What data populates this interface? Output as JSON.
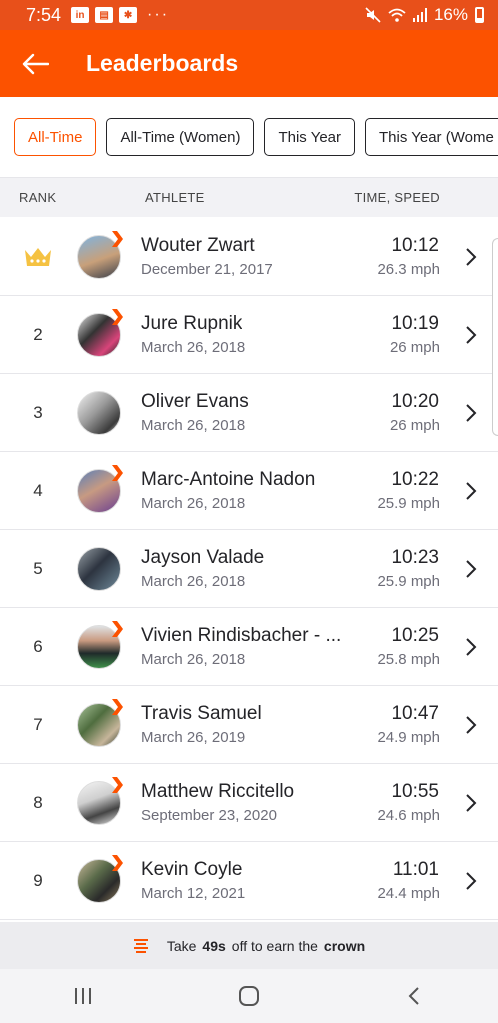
{
  "status_bar": {
    "time": "7:54",
    "icons": [
      "linkedin-icon",
      "news-icon",
      "nbc-icon"
    ],
    "battery": "16%"
  },
  "app_bar": {
    "title": "Leaderboards",
    "back_icon": "arrow-left-icon"
  },
  "filters": [
    {
      "label": "All-Time",
      "active": true
    },
    {
      "label": "All-Time (Women)",
      "active": false
    },
    {
      "label": "This Year",
      "active": false
    },
    {
      "label": "This Year (Wome",
      "active": false
    }
  ],
  "table_header": {
    "rank": "RANK",
    "athlete": "ATHLETE",
    "time_speed": "TIME, SPEED"
  },
  "rows": [
    {
      "rank": "",
      "rank_icon": "crown-icon",
      "name": "Wouter Zwart",
      "date": "December 21, 2017",
      "time": "10:12",
      "speed": "26.3 mph",
      "subscriber": true
    },
    {
      "rank": "2",
      "name": "Jure Rupnik",
      "date": "March 26, 2018",
      "time": "10:19",
      "speed": "26 mph",
      "subscriber": true
    },
    {
      "rank": "3",
      "name": "Oliver Evans",
      "date": "March 26, 2018",
      "time": "10:20",
      "speed": "26 mph",
      "subscriber": false
    },
    {
      "rank": "4",
      "name": "Marc-Antoine Nadon",
      "date": "March 26, 2018",
      "time": "10:22",
      "speed": "25.9 mph",
      "subscriber": true
    },
    {
      "rank": "5",
      "name": "Jayson Valade",
      "date": "March 26, 2018",
      "time": "10:23",
      "speed": "25.9 mph",
      "subscriber": false
    },
    {
      "rank": "6",
      "name": "Vivien  Rindisbacher - ...",
      "date": "March 26, 2018",
      "time": "10:25",
      "speed": "25.8 mph",
      "subscriber": true
    },
    {
      "rank": "7",
      "name": "Travis Samuel",
      "date": "March 26, 2019",
      "time": "10:47",
      "speed": "24.9 mph",
      "subscriber": true
    },
    {
      "rank": "8",
      "name": "Matthew Riccitello",
      "date": "September 23, 2020",
      "time": "10:55",
      "speed": "24.6 mph",
      "subscriber": true
    },
    {
      "rank": "9",
      "name": "Kevin Coyle",
      "date": "March 12, 2021",
      "time": "11:01",
      "speed": "24.4 mph",
      "subscriber": true
    }
  ],
  "banner": {
    "prefix": "Take",
    "seconds": "49s",
    "middle": "off to earn the",
    "crown": "crown"
  },
  "colors": {
    "accent": "#fc5200",
    "crown": "#f5c242"
  }
}
